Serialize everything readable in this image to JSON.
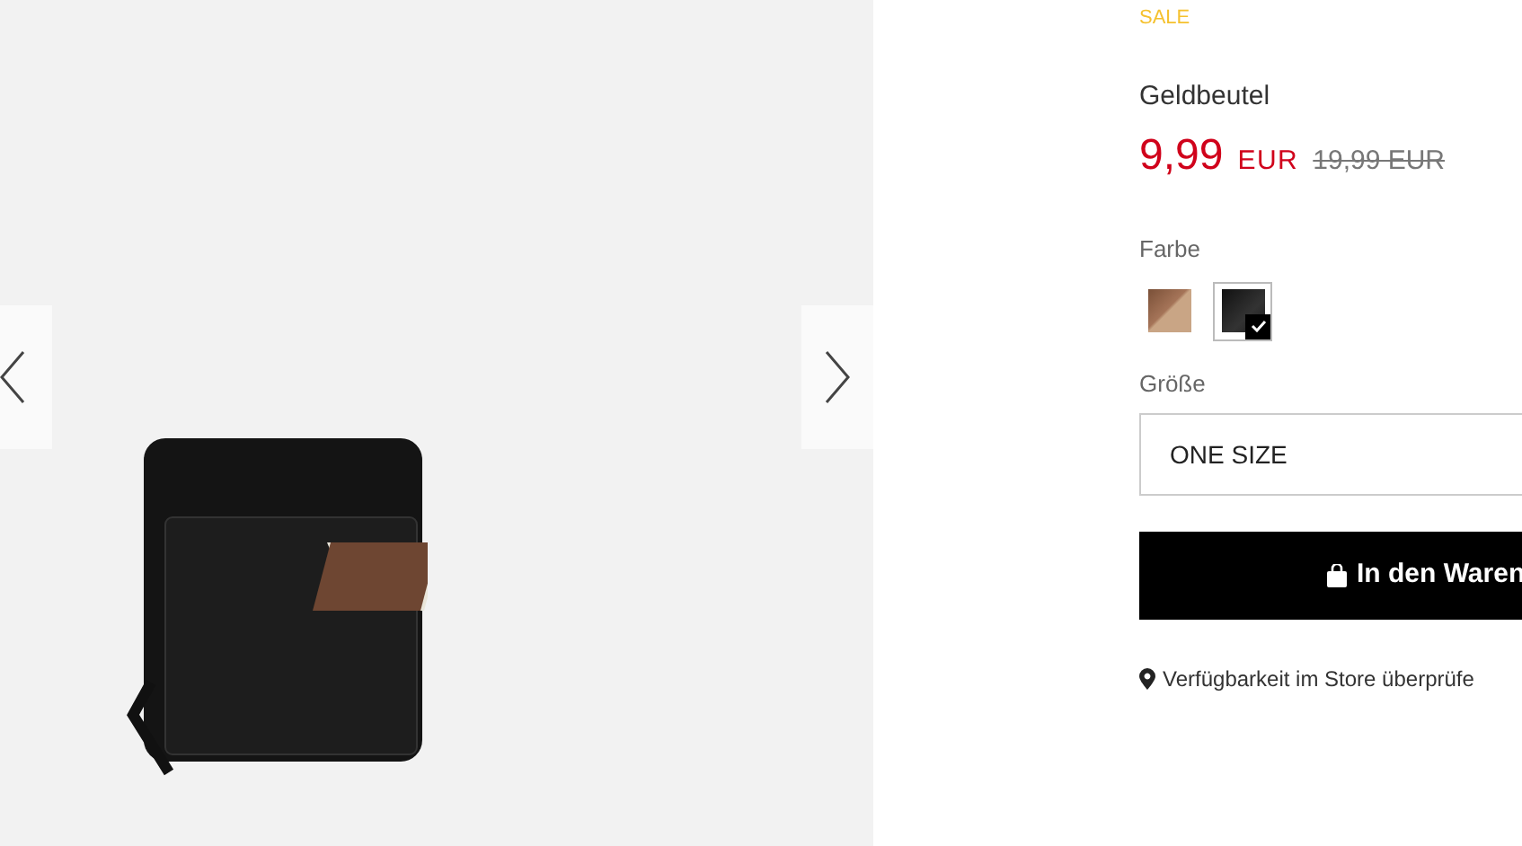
{
  "badge": "SALE",
  "product": {
    "name": "Geldbeutel",
    "price": "9,99",
    "currency": "EUR",
    "old_price": "19,99 EUR"
  },
  "color": {
    "label": "Farbe",
    "swatches": [
      {
        "kind": "wood",
        "selected": false
      },
      {
        "kind": "black",
        "selected": true
      }
    ]
  },
  "size": {
    "label": "Größe",
    "value": "ONE SIZE"
  },
  "add_to_cart": "In den Waren",
  "store_check": "Verfügbarkeit im Store überprüfe"
}
